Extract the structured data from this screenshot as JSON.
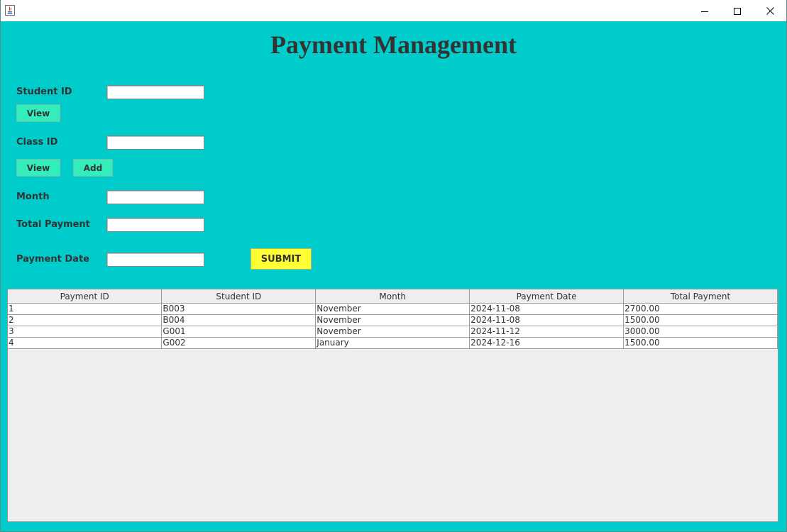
{
  "form": {
    "title": "Payment Management",
    "student_id_label": "Student ID",
    "student_id_value": "",
    "view_student_label": "View",
    "class_id_label": "Class ID",
    "class_id_value": "",
    "view_class_label": "View",
    "add_class_label": "Add",
    "month_label": "Month",
    "month_value": "",
    "total_payment_label": "Total Payment",
    "total_payment_value": "",
    "payment_date_label": "Payment Date",
    "payment_date_value": "",
    "submit_label": "SUBMIT"
  },
  "table": {
    "columns": [
      "Payment ID",
      "Student ID",
      "Month",
      "Payment Date",
      "Total Payment"
    ],
    "rows": [
      [
        "1",
        "B003",
        "November",
        "2024-11-08",
        "2700.00"
      ],
      [
        "2",
        "B004",
        "November",
        "2024-11-08",
        "1500.00"
      ],
      [
        "3",
        "G001",
        "November",
        "2024-11-12",
        "3000.00"
      ],
      [
        "4",
        "G002",
        "January",
        "2024-12-16",
        "1500.00"
      ]
    ]
  },
  "colors": {
    "background": "#00CCCC",
    "button": "#33EEBB",
    "submit": "#FFFF33",
    "text": "#333333"
  },
  "icons": {
    "app": "java-icon",
    "minimize": "minimize-icon",
    "maximize": "maximize-icon",
    "close": "close-icon"
  }
}
